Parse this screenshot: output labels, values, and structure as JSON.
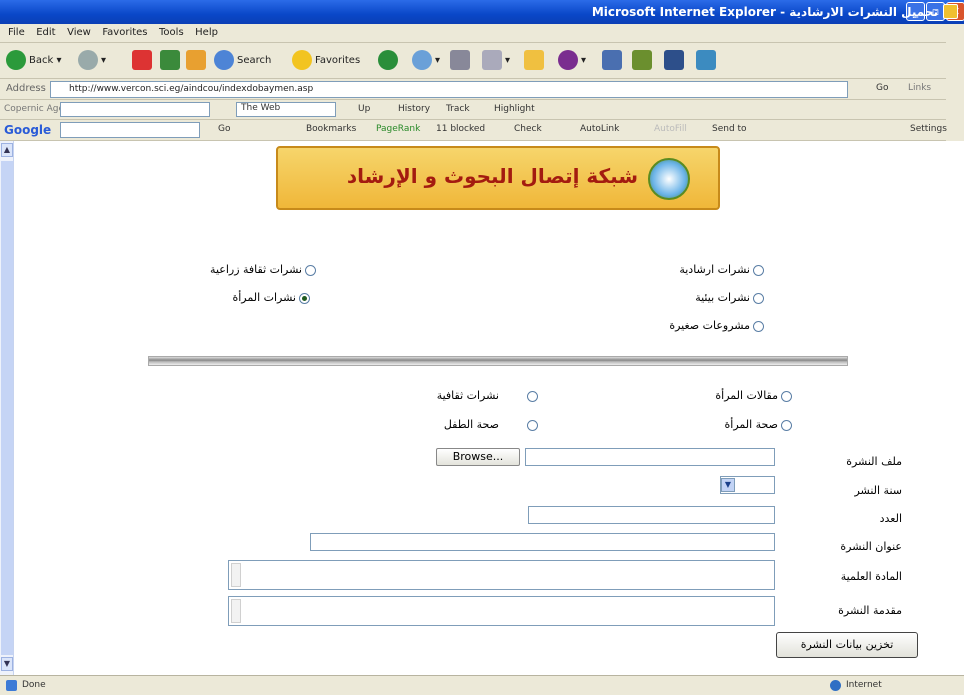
{
  "window": {
    "title": "تحميل النشرات الارشادية - Microsoft Internet Explorer",
    "buttons": [
      "_",
      "▫",
      "✕"
    ]
  },
  "menu": [
    "File",
    "Edit",
    "View",
    "Favorites",
    "Tools",
    "Help"
  ],
  "toolbar": {
    "back": "Back",
    "search": "Search",
    "favorites": "Favorites"
  },
  "address": {
    "label": "Address",
    "url": "http://www.vercon.sci.eg/aindcou/indexdobaymen.asp",
    "go": "Go",
    "links": "Links"
  },
  "links_bar": {
    "field_label": "Copernic Agent",
    "web": "The Web",
    "up": "Up",
    "history": "History",
    "track": "Track",
    "highlight": "Highlight"
  },
  "google_bar": {
    "brand": "Google",
    "go": "Go",
    "bookmarks": "Bookmarks",
    "pagerank": "PageRank",
    "blocked": "11 blocked",
    "check": "Check",
    "autolink": "AutoLink",
    "autofill": "AutoFill",
    "sendto": "Send to",
    "settings": "Settings"
  },
  "banner": {
    "text": "شبكة إتصال البحوث و الإرشاد"
  },
  "categories": {
    "right": [
      "نشرات ارشادية",
      "نشرات بيئية",
      "مشروعات صغيرة"
    ],
    "left": [
      "نشرات ثقافة زراعية",
      "نشرات المرأة"
    ],
    "selected": "نشرات المرأة"
  },
  "subcategories": {
    "right": [
      "مقالات المرأة",
      "صحة المرأة"
    ],
    "left": [
      "نشرات ثقافية",
      "صحة الطفل"
    ]
  },
  "form": {
    "file_label": "ملف النشرة",
    "browse": "Browse...",
    "year_label": "سنة النشر",
    "number_label": "العدد",
    "title_label": "عنوان النشرة",
    "subject_label": "المادة العلمية",
    "intro_label": "مقدمة النشرة",
    "submit": "تخزين بيانات النشرة"
  },
  "status": {
    "left": "Done",
    "right": "Internet"
  }
}
